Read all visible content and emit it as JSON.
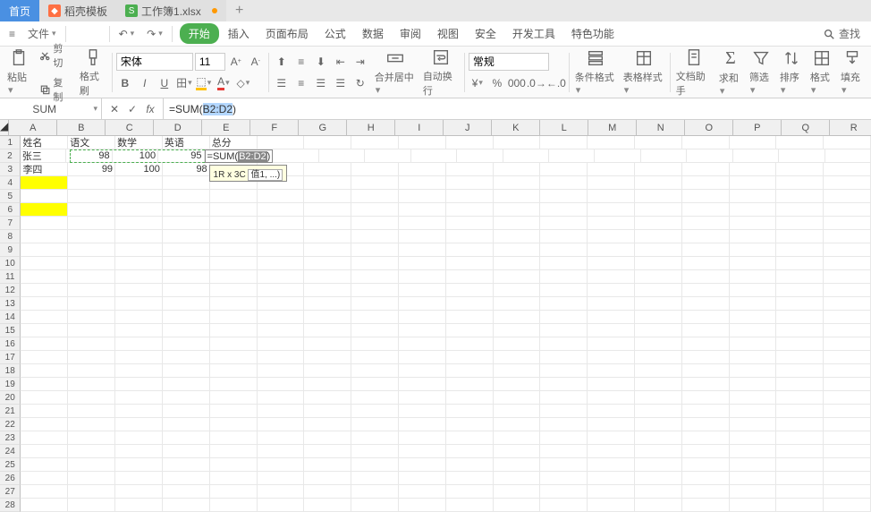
{
  "tabs": [
    {
      "label": "首页",
      "active": true
    },
    {
      "label": "稻壳模板",
      "icon": "orange"
    },
    {
      "label": "工作簿1.xlsx",
      "icon": "green"
    }
  ],
  "file_menu_label": "文件",
  "ribbon": {
    "tabs": [
      "开始",
      "插入",
      "页面布局",
      "公式",
      "数据",
      "审阅",
      "视图",
      "安全",
      "开发工具",
      "特色功能"
    ],
    "active_index": 0,
    "search_label": "查找"
  },
  "toolbar": {
    "paste": "粘贴",
    "cut": "剪切",
    "copy": "复制",
    "format_painter": "格式刷",
    "font_name": "宋体",
    "font_size": "11",
    "merge_center": "合并居中",
    "wrap_text": "自动换行",
    "number_format": "常规",
    "cond_format": "条件格式",
    "table_style": "表格样式",
    "doc_assist": "文档助手",
    "sum": "求和",
    "filter": "筛选",
    "sort": "排序",
    "format": "格式",
    "fill": "填充"
  },
  "formula_bar": {
    "name_box": "SUM",
    "formula_prefix": "=SUM(",
    "formula_ref": "B2:D2",
    "formula_suffix": ")"
  },
  "columns": [
    "A",
    "B",
    "C",
    "D",
    "E",
    "F",
    "G",
    "H",
    "I",
    "J",
    "K",
    "L",
    "M",
    "N",
    "O",
    "P",
    "Q",
    "R"
  ],
  "row_count": 28,
  "headers_row": {
    "A": "姓名",
    "B": "语文",
    "C": "数学",
    "D": "英语",
    "E": "总分"
  },
  "data_rows": [
    {
      "A": "张三",
      "B": "98",
      "C": "100",
      "D": "95"
    },
    {
      "A": "李四",
      "B": "99",
      "C": "100",
      "D": "98"
    }
  ],
  "yellow_cells": [
    "A4",
    "A6"
  ],
  "editing": {
    "cell": "E2",
    "display_prefix": "=SUM(",
    "display_ref": "B2:D2",
    "display_suffix": ")",
    "hint": "1R x 3C",
    "fn_hint": "值1, ...)"
  },
  "chart_data": {
    "type": "table",
    "title": "",
    "columns": [
      "姓名",
      "语文",
      "数学",
      "英语",
      "总分"
    ],
    "rows": [
      {
        "姓名": "张三",
        "语文": 98,
        "数学": 100,
        "英语": 95,
        "总分": null
      },
      {
        "姓名": "李四",
        "语文": 99,
        "数学": 100,
        "英语": 98,
        "总分": null
      }
    ]
  }
}
